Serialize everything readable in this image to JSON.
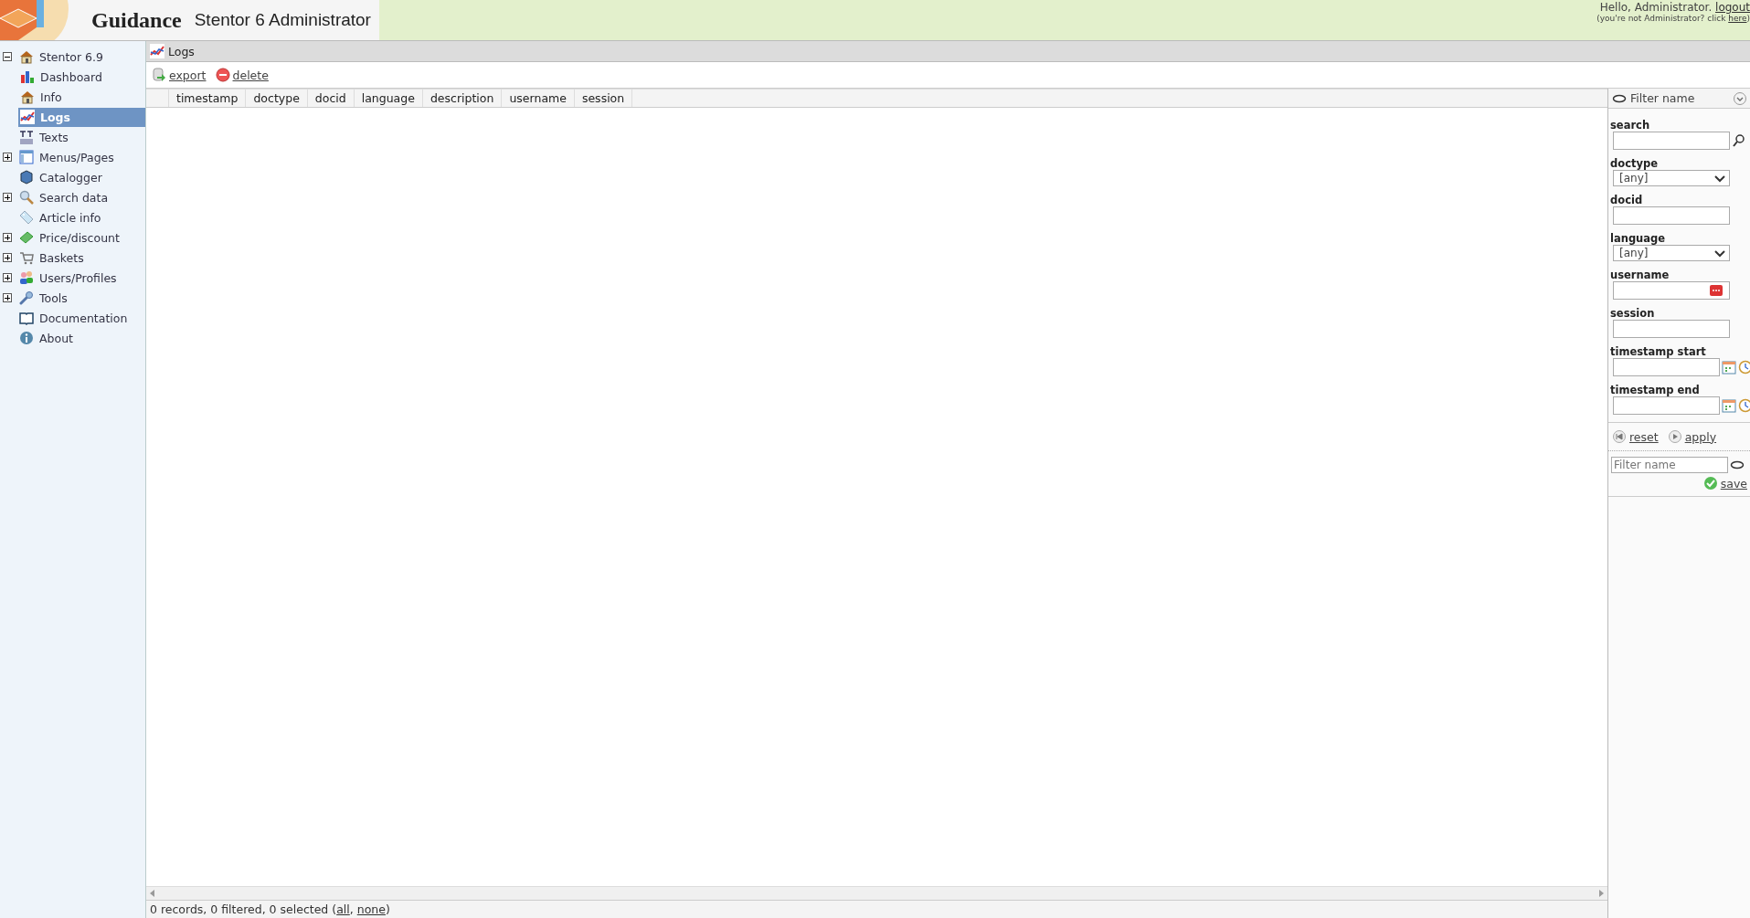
{
  "header": {
    "brand": "Guidance",
    "product": "Stentor 6 Administrator",
    "greeting": [
      {
        "text": "Hello, Administrator. "
      },
      {
        "link": "logout"
      }
    ],
    "notice": [
      {
        "text": "(you're not Administrator? click "
      },
      {
        "link": "here"
      },
      {
        "text": ")"
      }
    ]
  },
  "sidebar": {
    "items": [
      {
        "label": "Stentor 6.9",
        "kind": "house",
        "expanded": true,
        "selected": false,
        "children": [
          {
            "label": "Dashboard",
            "kind": "chart",
            "selected": false
          },
          {
            "label": "Info",
            "kind": "house",
            "selected": false
          },
          {
            "label": "Logs",
            "kind": "graph",
            "selected": true
          }
        ]
      },
      {
        "label": "Texts",
        "kind": "text",
        "selected": false
      },
      {
        "label": "Menus/Pages",
        "kind": "window",
        "expanded": false,
        "selected": false
      },
      {
        "label": "Catalogger",
        "kind": "cube",
        "selected": false
      },
      {
        "label": "Search data",
        "kind": "search",
        "expanded": false,
        "selected": false
      },
      {
        "label": "Article info",
        "kind": "tag",
        "selected": false
      },
      {
        "label": "Price/discount",
        "kind": "money",
        "expanded": false,
        "selected": false
      },
      {
        "label": "Baskets",
        "kind": "cart",
        "expanded": false,
        "selected": false
      },
      {
        "label": "Users/Profiles",
        "kind": "users",
        "expanded": false,
        "selected": false
      },
      {
        "label": "Tools",
        "kind": "wrench",
        "expanded": false,
        "selected": false
      },
      {
        "label": "Documentation",
        "kind": "book",
        "selected": false
      },
      {
        "label": "About",
        "kind": "info",
        "selected": false
      }
    ]
  },
  "panel": {
    "title": "Logs",
    "actions": [
      {
        "label": "export",
        "kind": "export"
      },
      {
        "label": "delete",
        "kind": "delete"
      }
    ]
  },
  "table": {
    "columns": [
      "timestamp",
      "doctype",
      "docid",
      "language",
      "description",
      "username",
      "session"
    ]
  },
  "status_bar": [
    {
      "text": "0 records, 0 filtered, 0 selected ("
    },
    {
      "link": "all"
    },
    {
      "text": ", "
    },
    {
      "link": "none"
    },
    {
      "text": ")"
    }
  ],
  "filter": {
    "title": "Filter name",
    "fields": [
      {
        "label": "search",
        "kind": "search"
      },
      {
        "label": "doctype",
        "kind": "select",
        "value": "[any]"
      },
      {
        "label": "docid",
        "kind": "text"
      },
      {
        "label": "language",
        "kind": "select",
        "value": "[any]"
      },
      {
        "label": "username",
        "kind": "picker"
      },
      {
        "label": "session",
        "kind": "text"
      },
      {
        "label": "timestamp start",
        "kind": "datetime"
      },
      {
        "label": "timestamp end",
        "kind": "datetime"
      }
    ],
    "actions": [
      {
        "label": "reset",
        "kind": "reset"
      },
      {
        "label": "apply",
        "kind": "apply"
      }
    ],
    "save": {
      "placeholder": "Filter name",
      "label": "save"
    }
  }
}
